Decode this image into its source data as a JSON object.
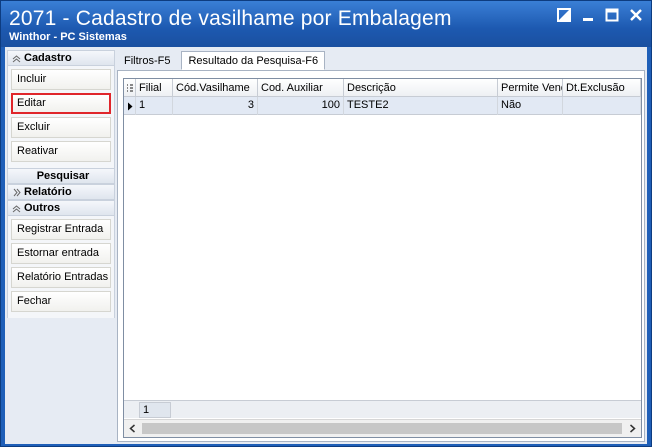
{
  "window": {
    "title": "2071 - Cadastro de vasilhame por Embalagem",
    "subtitle": "Winthor - PC Sistemas"
  },
  "nav": {
    "cadastro": {
      "header": "Cadastro",
      "items": [
        "Incluir",
        "Editar",
        "Excluir",
        "Reativar"
      ]
    },
    "pesquisar": {
      "header": "Pesquisar"
    },
    "relatorio": {
      "header": "Relatório"
    },
    "outros": {
      "header": "Outros",
      "items": [
        "Registrar Entrada",
        "Estornar entrada",
        "Relatório Entradas",
        "Fechar"
      ]
    }
  },
  "tabs": [
    "Filtros-F5",
    "Resultado da Pesquisa-F6"
  ],
  "grid": {
    "columns": [
      "Filial",
      "Cód.Vasilhame",
      "Cod. Auxiliar",
      "Descrição",
      "Permite Vend",
      "Dt.Exclusão"
    ],
    "rows": [
      [
        "1",
        "3",
        "100",
        "TESTE2",
        "Não",
        ""
      ]
    ],
    "footer_count": "1"
  },
  "icons": {
    "restore": "restore-icon",
    "minimize": "minimize-icon",
    "maximize": "maximize-icon",
    "close": "close-icon"
  },
  "colors": {
    "titlebar": "#1d59b0",
    "selected_border": "#e0262b",
    "row_highlight": "#e2e9f4"
  }
}
